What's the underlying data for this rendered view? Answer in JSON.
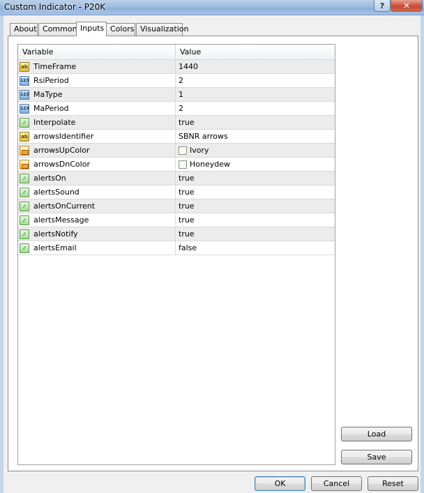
{
  "window": {
    "title": "Custom Indicator - P20K",
    "help_label": "?",
    "close_label": "✕"
  },
  "tabs": [
    {
      "label": "About"
    },
    {
      "label": "Common"
    },
    {
      "label": "Inputs",
      "active": true
    },
    {
      "label": "Colors"
    },
    {
      "label": "Visualization"
    }
  ],
  "grid": {
    "headers": {
      "variable": "Variable",
      "value": "Value"
    },
    "rows": [
      {
        "icon": "ab-string-icon",
        "variable": "TimeFrame",
        "value": "1440"
      },
      {
        "icon": "123-number-icon",
        "variable": "RsiPeriod",
        "value": "2"
      },
      {
        "icon": "123-number-icon",
        "variable": "MaType",
        "value": "1"
      },
      {
        "icon": "123-number-icon",
        "variable": "MaPeriod",
        "value": "2"
      },
      {
        "icon": "bool-icon",
        "variable": "Interpolate",
        "value": "true"
      },
      {
        "icon": "ab-string-icon",
        "variable": "arrowsIdentifier",
        "value": "SBNR arrows"
      },
      {
        "icon": "color-icon",
        "variable": "arrowsUpColor",
        "value": "Ivory",
        "swatch": "#fffff0"
      },
      {
        "icon": "color-icon",
        "variable": "arrowsDnColor",
        "value": "Honeydew",
        "swatch": "#f0fff0"
      },
      {
        "icon": "bool-icon",
        "variable": "alertsOn",
        "value": "true"
      },
      {
        "icon": "bool-icon",
        "variable": "alertsSound",
        "value": "true"
      },
      {
        "icon": "bool-icon",
        "variable": "alertsOnCurrent",
        "value": "true"
      },
      {
        "icon": "bool-icon",
        "variable": "alertsMessage",
        "value": "true"
      },
      {
        "icon": "bool-icon",
        "variable": "alertsNotify",
        "value": "true"
      },
      {
        "icon": "bool-icon",
        "variable": "alertsEmail",
        "value": "false"
      }
    ]
  },
  "buttons": {
    "load": "Load",
    "save": "Save",
    "ok": "OK",
    "cancel": "Cancel",
    "reset": "Reset"
  }
}
